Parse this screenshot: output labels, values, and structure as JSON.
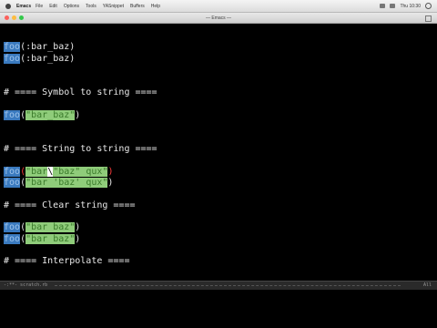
{
  "menubar": {
    "app": "Emacs",
    "items": [
      "File",
      "Edit",
      "Options",
      "Tools",
      "YASnippet",
      "Buffers",
      "Help"
    ],
    "status": "Thu 10:30"
  },
  "window": {
    "title": "— Emacs —"
  },
  "editor": {
    "l1": {
      "fn": "foo",
      "open": "(",
      "arg": ":bar_baz",
      "close": ")"
    },
    "l2": {
      "fn": "foo",
      "open": "(",
      "arg": ":bar_baz",
      "close": ")"
    },
    "c1": "# ==== Symbol to string ====",
    "l3": {
      "fn": "foo",
      "open": "(",
      "str": "\"bar_baz\"",
      "close": ")"
    },
    "c2": "# ==== String to string ====",
    "l4": {
      "fn": "foo",
      "open": "(",
      "s1": "\"bar",
      "cur": "\\",
      "s2": "\"baz\" qux\"",
      "close": ")"
    },
    "l5": {
      "fn": "foo",
      "open": "(",
      "str": "\"bar 'baz' qux\"",
      "close": ")"
    },
    "c3": "# ==== Clear string ====",
    "l6": {
      "fn": "foo",
      "open": "(",
      "str": "\"bar baz\"",
      "close": ")"
    },
    "l7": {
      "fn": "foo",
      "open": "(",
      "str": "\"bar baz\"",
      "close": ")"
    },
    "c4": "# ==== Interpolate ===="
  },
  "modeline": {
    "left": "-:**- scratch.rb",
    "right": "All"
  }
}
